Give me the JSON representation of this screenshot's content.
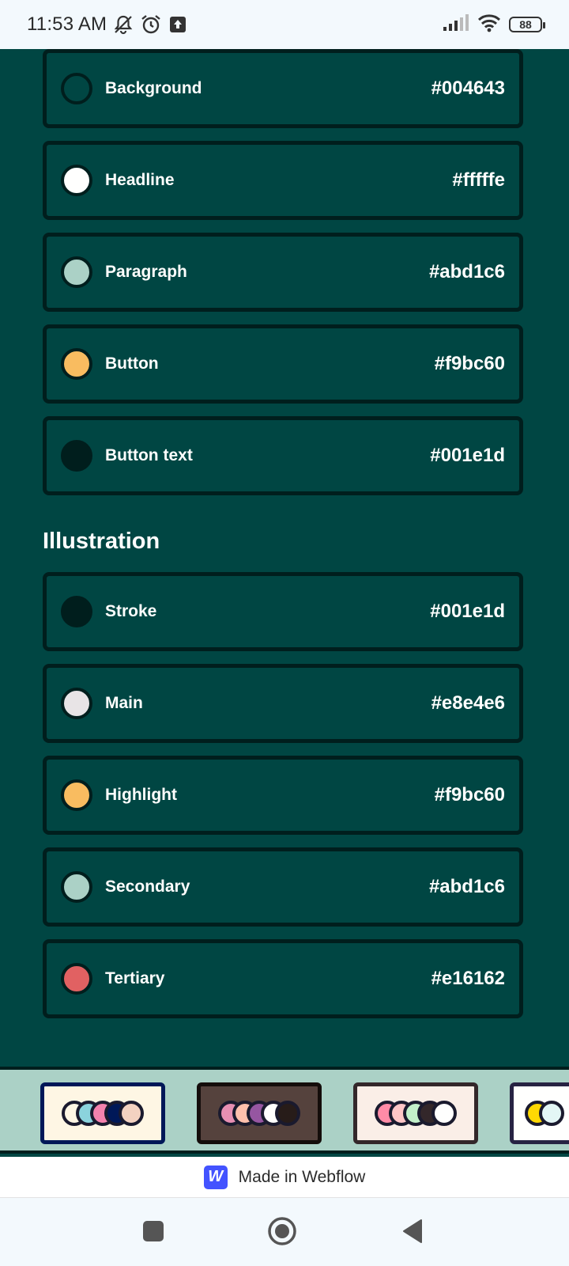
{
  "status_bar": {
    "time": "11:53 AM",
    "battery": "88"
  },
  "core_colors": [
    {
      "label": "Background",
      "hex": "#004643",
      "color": "#004643"
    },
    {
      "label": "Headline",
      "hex": "#fffffe",
      "color": "#fffffe"
    },
    {
      "label": "Paragraph",
      "hex": "#abd1c6",
      "color": "#abd1c6"
    },
    {
      "label": "Button",
      "hex": "#f9bc60",
      "color": "#f9bc60"
    },
    {
      "label": "Button text",
      "hex": "#001e1d",
      "color": "#001e1d"
    }
  ],
  "illustration": {
    "title": "Illustration",
    "colors": [
      {
        "label": "Stroke",
        "hex": "#001e1d",
        "color": "#001e1d"
      },
      {
        "label": "Main",
        "hex": "#e8e4e6",
        "color": "#e8e4e6"
      },
      {
        "label": "Highlight",
        "hex": "#f9bc60",
        "color": "#f9bc60"
      },
      {
        "label": "Secondary",
        "hex": "#abd1c6",
        "color": "#abd1c6"
      },
      {
        "label": "Tertiary",
        "hex": "#e16162",
        "color": "#e16162"
      }
    ]
  },
  "palettes": [
    {
      "bg": "#fef6e4",
      "border": "#001858",
      "dots": [
        "#fef6e4",
        "#8bd3dd",
        "#f582ae",
        "#001858",
        "#f3d2c1"
      ]
    },
    {
      "bg": "#55423d",
      "border": "#140d0b",
      "dots": [
        "#e78fb3",
        "#ffc0ad",
        "#9656a1",
        "#fffffe",
        "#271c19"
      ]
    },
    {
      "bg": "#faeee7",
      "border": "#33272a",
      "dots": [
        "#ff8ba7",
        "#ffc6c7",
        "#c3f0ca",
        "#33272a",
        "#fffffe"
      ]
    },
    {
      "bg": "#fffffe",
      "border": "#272343",
      "dots": [
        "#ffd803",
        "#e3f6f5"
      ]
    }
  ],
  "webflow": {
    "label": "Made in Webflow",
    "logo_letter": "W"
  }
}
